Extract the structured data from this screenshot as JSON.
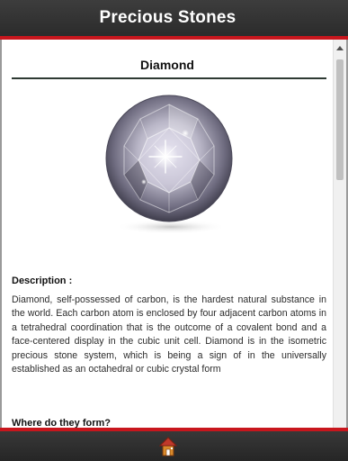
{
  "header": {
    "title": "Precious Stones"
  },
  "stone": {
    "name": "Diamond",
    "image_icon": "diamond-gem-image"
  },
  "sections": [
    {
      "heading": "Description :",
      "text": "Diamond, self-possessed of carbon, is the hardest natural substance in the world. Each carbon atom is enclosed by four adjacent carbon atoms in a tetrahedral coordination that is the outcome of a covalent bond and a face-centered display in the cubic unit cell. Diamond is in the isometric precious stone system, which is being a sign of in the universally established as an octahedral or cubic crystal form"
    },
    {
      "heading": "Where do they form?"
    }
  ],
  "footer": {
    "home_icon": "home-icon"
  },
  "colors": {
    "header_bg": "#333333",
    "accent_red": "#c8161d",
    "title_rule": "#2e3a33",
    "body_text": "#2c2c2c"
  }
}
